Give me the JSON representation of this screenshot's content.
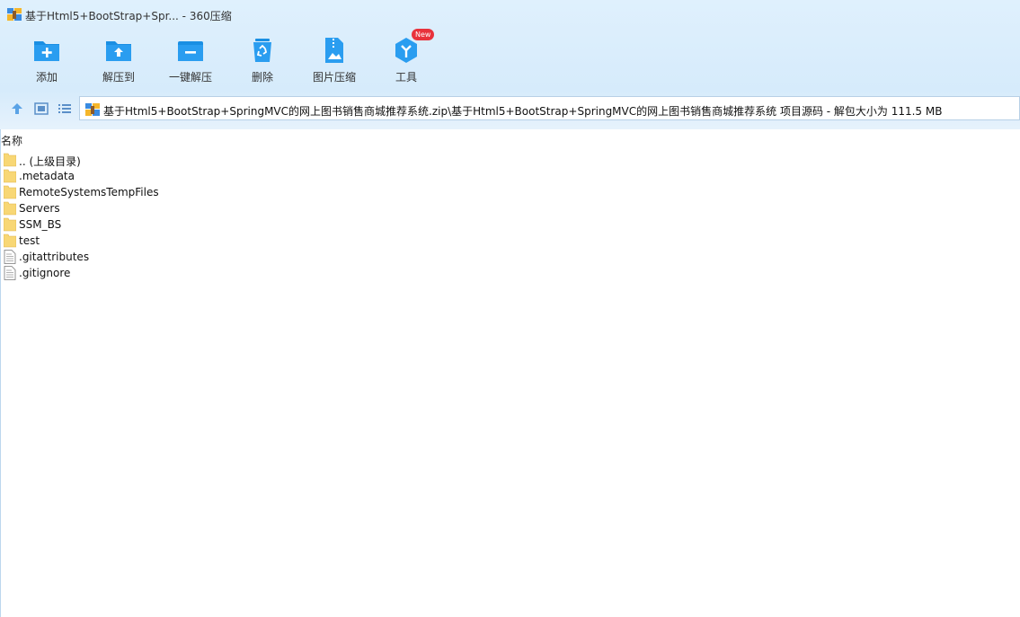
{
  "window": {
    "title": "基于Html5+BootStrap+Spr... - 360压缩"
  },
  "toolbar": {
    "items": [
      {
        "label": "添加",
        "icon": "add-folder-icon"
      },
      {
        "label": "解压到",
        "icon": "extract-to-icon"
      },
      {
        "label": "一键解压",
        "icon": "one-click-extract-icon"
      },
      {
        "label": "删除",
        "icon": "recycle-bin-icon"
      },
      {
        "label": "图片压缩",
        "icon": "image-compress-icon"
      },
      {
        "label": "工具",
        "icon": "tools-icon",
        "badge": "New"
      }
    ]
  },
  "navigation": {
    "up_icon": "up-arrow-icon",
    "view_icon": "thumbnail-view-icon",
    "list_icon": "list-view-icon",
    "address_path": "基于Html5+BootStrap+SpringMVC的网上图书销售商城推荐系统.zip\\基于Html5+BootStrap+SpringMVC的网上图书销售商城推荐系统 项目源码 - 解包大小为 111.5 MB"
  },
  "file_list": {
    "column_name": "名称",
    "items": [
      {
        "name": ".. (上级目录)",
        "type": "folder"
      },
      {
        "name": ".metadata",
        "type": "folder"
      },
      {
        "name": "RemoteSystemsTempFiles",
        "type": "folder"
      },
      {
        "name": "Servers",
        "type": "folder"
      },
      {
        "name": "SSM_BS",
        "type": "folder"
      },
      {
        "name": "test",
        "type": "folder"
      },
      {
        "name": ".gitattributes",
        "type": "file"
      },
      {
        "name": ".gitignore",
        "type": "file"
      }
    ]
  },
  "colors": {
    "accent_blue": "#1a8fe3",
    "toolbar_bg": "#d6ebfb",
    "folder_yellow": "#f8d775",
    "badge_red": "#e8323c"
  }
}
